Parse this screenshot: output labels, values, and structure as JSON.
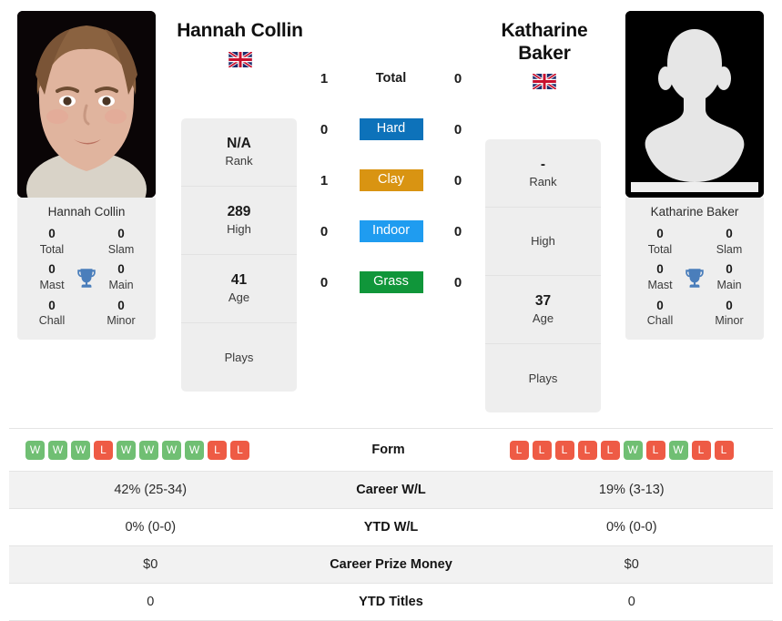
{
  "players": {
    "left": {
      "name": "Hannah Collin",
      "card_name": "Hannah Collin",
      "country": "GB",
      "avatar": "photo",
      "titles": [
        {
          "value": "0",
          "label": "Total"
        },
        {
          "value": "0",
          "label": "Slam"
        },
        {
          "value": "0",
          "label": "Mast"
        },
        {
          "value": "0",
          "label": "Main"
        },
        {
          "value": "0",
          "label": "Chall"
        },
        {
          "value": "0",
          "label": "Minor"
        }
      ],
      "info": [
        {
          "value": "N/A",
          "label": "Rank"
        },
        {
          "value": "289",
          "label": "High"
        },
        {
          "value": "41",
          "label": "Age"
        },
        {
          "value": "",
          "label": "Plays"
        }
      ],
      "form": [
        "W",
        "W",
        "W",
        "L",
        "W",
        "W",
        "W",
        "W",
        "L",
        "L"
      ],
      "career_wl": "42% (25-34)",
      "ytd_wl": "0% (0-0)",
      "career_prize_money": "$0",
      "ytd_titles": "0"
    },
    "right": {
      "name": "Katharine Baker",
      "card_name": "Katharine Baker",
      "country": "GB",
      "avatar": "silhouette",
      "titles": [
        {
          "value": "0",
          "label": "Total"
        },
        {
          "value": "0",
          "label": "Slam"
        },
        {
          "value": "0",
          "label": "Mast"
        },
        {
          "value": "0",
          "label": "Main"
        },
        {
          "value": "0",
          "label": "Chall"
        },
        {
          "value": "0",
          "label": "Minor"
        }
      ],
      "info": [
        {
          "value": "-",
          "label": "Rank"
        },
        {
          "value": "",
          "label": "High"
        },
        {
          "value": "37",
          "label": "Age"
        },
        {
          "value": "",
          "label": "Plays"
        }
      ],
      "form": [
        "L",
        "L",
        "L",
        "L",
        "L",
        "W",
        "L",
        "W",
        "L",
        "L"
      ],
      "career_wl": "19% (3-13)",
      "ytd_wl": "0% (0-0)",
      "career_prize_money": "$0",
      "ytd_titles": "0"
    }
  },
  "head_to_head": [
    {
      "label": "Total",
      "left": "1",
      "right": "0",
      "color": "",
      "badge": false
    },
    {
      "label": "Hard",
      "left": "0",
      "right": "0",
      "color": "#0d72ba",
      "badge": true
    },
    {
      "label": "Clay",
      "left": "1",
      "right": "0",
      "color": "#d99412",
      "badge": true
    },
    {
      "label": "Indoor",
      "left": "0",
      "right": "0",
      "color": "#1f9cf0",
      "badge": true
    },
    {
      "label": "Grass",
      "left": "0",
      "right": "0",
      "color": "#10963a",
      "badge": true
    }
  ],
  "comparison_rows": [
    {
      "label": "Form",
      "left": "",
      "right": ""
    },
    {
      "label": "Career W/L",
      "left": "42% (25-34)",
      "right": "19% (3-13)"
    },
    {
      "label": "YTD W/L",
      "left": "0% (0-0)",
      "right": "0% (0-0)"
    },
    {
      "label": "Career Prize Money",
      "left": "$0",
      "right": "$0"
    },
    {
      "label": "YTD Titles",
      "left": "0",
      "right": "0"
    }
  ],
  "colors": {
    "win": "#70bf73",
    "loss": "#ee5b45",
    "trophy": "#4a7ebb",
    "card_bg": "#eeeeee",
    "row_alt": "#f2f2f2"
  }
}
